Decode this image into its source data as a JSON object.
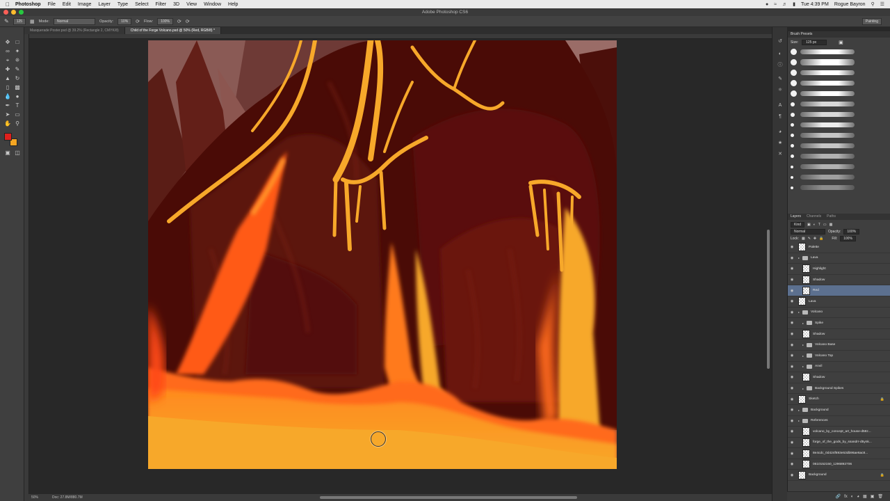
{
  "menubar": {
    "app_name": "Photoshop",
    "items": [
      "File",
      "Edit",
      "Image",
      "Layer",
      "Type",
      "Select",
      "Filter",
      "3D",
      "View",
      "Window",
      "Help"
    ],
    "clock": "Tue 4:39 PM",
    "user": "Rogue Bayron"
  },
  "window": {
    "title": "Adobe Photoshop CS6"
  },
  "options": {
    "mode_label": "Mode:",
    "mode_value": "Normal",
    "opacity_label": "Opacity:",
    "opacity_value": "10%",
    "flow_label": "Flow:",
    "flow_value": "100%",
    "brush_size": "125",
    "workspace": "Painting"
  },
  "tabs": [
    {
      "label": "Masquerade Poster.psd @ 39.2% (Rectangle 2, CMYK/8)",
      "active": false
    },
    {
      "label": "Child of the Forge Volcano.psd @ 50% (Red, RGB/8) *",
      "active": true
    }
  ],
  "colors": {
    "foreground": "#e0201c",
    "background": "#f5a623",
    "selection": "#5c708f"
  },
  "status": {
    "zoom": "50%",
    "doc": "Doc: 27.8M/880.7M"
  },
  "brush_presets": {
    "title": "Brush Presets",
    "size_label": "Size:",
    "size_value": "125 px"
  },
  "layers_panel": {
    "tabs": [
      "Layers",
      "Channels",
      "Paths"
    ],
    "filter": "Kind",
    "blend": "Normal",
    "opacity_label": "Opacity:",
    "opacity_value": "100%",
    "lock_label": "Lock:",
    "fill_label": "Fill:",
    "fill_value": "100%",
    "layers": [
      {
        "name": "Palette",
        "type": "layer",
        "indent": 0
      },
      {
        "name": "Lava",
        "type": "group",
        "indent": 0
      },
      {
        "name": "Highlight",
        "type": "layer",
        "indent": 1
      },
      {
        "name": "Shadow",
        "type": "layer",
        "indent": 1
      },
      {
        "name": "Red",
        "type": "layer",
        "indent": 1,
        "selected": true
      },
      {
        "name": "Lava",
        "type": "layer",
        "indent": 0
      },
      {
        "name": "Volcano",
        "type": "group",
        "indent": 0
      },
      {
        "name": "Spike",
        "type": "group",
        "indent": 1
      },
      {
        "name": "Shadow",
        "type": "layer",
        "indent": 1
      },
      {
        "name": "Volcano Base",
        "type": "group",
        "indent": 1
      },
      {
        "name": "Volcano Top",
        "type": "group",
        "indent": 1
      },
      {
        "name": "Anvil",
        "type": "group",
        "indent": 1
      },
      {
        "name": "Shadow",
        "type": "layer",
        "indent": 1
      },
      {
        "name": "Background Spikes",
        "type": "group",
        "indent": 1
      },
      {
        "name": "Sketch",
        "type": "layer",
        "indent": 0,
        "locked": true
      },
      {
        "name": "Background",
        "type": "group",
        "indent": 0
      },
      {
        "name": "References",
        "type": "group",
        "indent": 0
      },
      {
        "name": "volcano_by_concept_art_house-d58z...",
        "type": "layer",
        "indent": 1
      },
      {
        "name": "forge_of_the_gods_by_ssandrr-d5ynk...",
        "type": "layer",
        "indent": 1
      },
      {
        "name": "8e4cdc_0d424f693e53db96ae6ac8...",
        "type": "layer",
        "indent": 1
      },
      {
        "name": "0610152150_1296892706",
        "type": "layer",
        "indent": 1
      },
      {
        "name": "Background",
        "type": "layer",
        "indent": 0,
        "locked": true
      }
    ]
  }
}
